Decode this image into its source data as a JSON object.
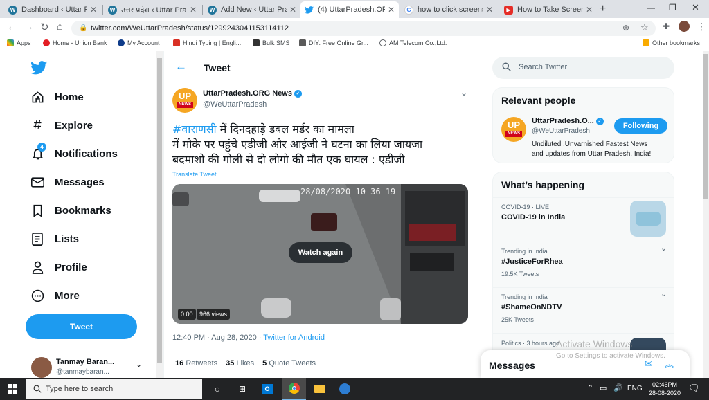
{
  "browser": {
    "tabs": [
      {
        "title": "Dashboard ‹ Uttar Prad",
        "icon": "wordpress-icon"
      },
      {
        "title": "उत्तर प्रदेश ‹ Uttar Prades",
        "icon": "wordpress-icon"
      },
      {
        "title": "Add New ‹ Uttar Prades",
        "icon": "wordpress-icon"
      },
      {
        "title": "(4) UttarPradesh.ORG N",
        "icon": "twitter-icon"
      },
      {
        "title": "how to click screensho",
        "icon": "google-icon"
      },
      {
        "title": "How to Take Screensho",
        "icon": "youtube-icon"
      }
    ],
    "url": "twitter.com/WeUttarPradesh/status/1299243041153114112",
    "bookmarks": [
      "Apps",
      "Home - Union Bank",
      "My Account",
      "Hindi Typing | Engli...",
      "Bulk SMS",
      "DIY: Free Online Gr...",
      "AM Telecom Co.,Ltd."
    ],
    "other_bookmarks": "Other bookmarks"
  },
  "sidebar": {
    "items": [
      {
        "label": "Home",
        "icon": "home-icon"
      },
      {
        "label": "Explore",
        "icon": "hashtag-icon"
      },
      {
        "label": "Notifications",
        "icon": "bell-icon",
        "badge": "4"
      },
      {
        "label": "Messages",
        "icon": "envelope-icon"
      },
      {
        "label": "Bookmarks",
        "icon": "bookmark-icon"
      },
      {
        "label": "Lists",
        "icon": "list-icon"
      },
      {
        "label": "Profile",
        "icon": "person-icon"
      },
      {
        "label": "More",
        "icon": "more-icon"
      }
    ],
    "tweet_button": "Tweet",
    "account": {
      "name": "Tanmay Baran...",
      "handle": "@tanmaybaran..."
    }
  },
  "main": {
    "header_title": "Tweet",
    "tweet": {
      "author_name": "UttarPradesh.ORG News",
      "author_handle": "@WeUttarPradesh",
      "avatar_text_top": "UP",
      "avatar_text_bottom": "NEWS",
      "hashtag": "#वाराणसी",
      "line1_rest": " में दिनदहाड़े डबल मर्डर का मामला",
      "line2": "में मौके पर पहुंचे एडीजी और आईजी ने घटना का लिया जायजा",
      "line3": "बदमाशो की गोली से दो लोगो की मौत एक घायल : एडीजी",
      "translate": "Translate Tweet",
      "video": {
        "timestamp": "28/08/2020 10 36 19",
        "watch_again": "Watch again",
        "time": "0:00",
        "views": "966 views"
      },
      "meta_time": "12:40 PM · Aug 28, 2020",
      "meta_source": "Twitter for Android",
      "retweets_count": "16",
      "retweets_label": "Retweets",
      "likes_count": "35",
      "likes_label": "Likes",
      "quotes_count": "5",
      "quotes_label": "Quote Tweets"
    }
  },
  "right": {
    "search_placeholder": "Search Twitter",
    "relevant_title": "Relevant people",
    "person": {
      "name": "UttarPradesh.O...",
      "handle": "@WeUttarPradesh",
      "following": "Following",
      "bio_line1": "Undiluted ,Unvarnished Fastest News",
      "bio_line2": "and updates from Uttar Pradesh, India!"
    },
    "happening_title": "What’s happening",
    "trends": [
      {
        "meta": "COVID-19 · LIVE",
        "title": "COVID-19 in India",
        "count": ""
      },
      {
        "meta": "Trending in India",
        "title": "#JusticeForRhea",
        "count": "19.5K Tweets"
      },
      {
        "meta": "Trending in India",
        "title": "#ShameOnNDTV",
        "count": "25K Tweets"
      },
      {
        "meta": "Politics · 3 hours ago",
        "title": "",
        "count": ""
      }
    ],
    "messages_title": "Messages",
    "activate_line1": "Activate Windows",
    "activate_line2": "Go to Settings to activate Windows."
  },
  "taskbar": {
    "search_placeholder": "Type here to search",
    "lang": "ENG",
    "time": "02:46PM",
    "date": "28-08-2020"
  },
  "colors": {
    "twitter_blue": "#1d9bf0",
    "taskbar": "#222325"
  }
}
